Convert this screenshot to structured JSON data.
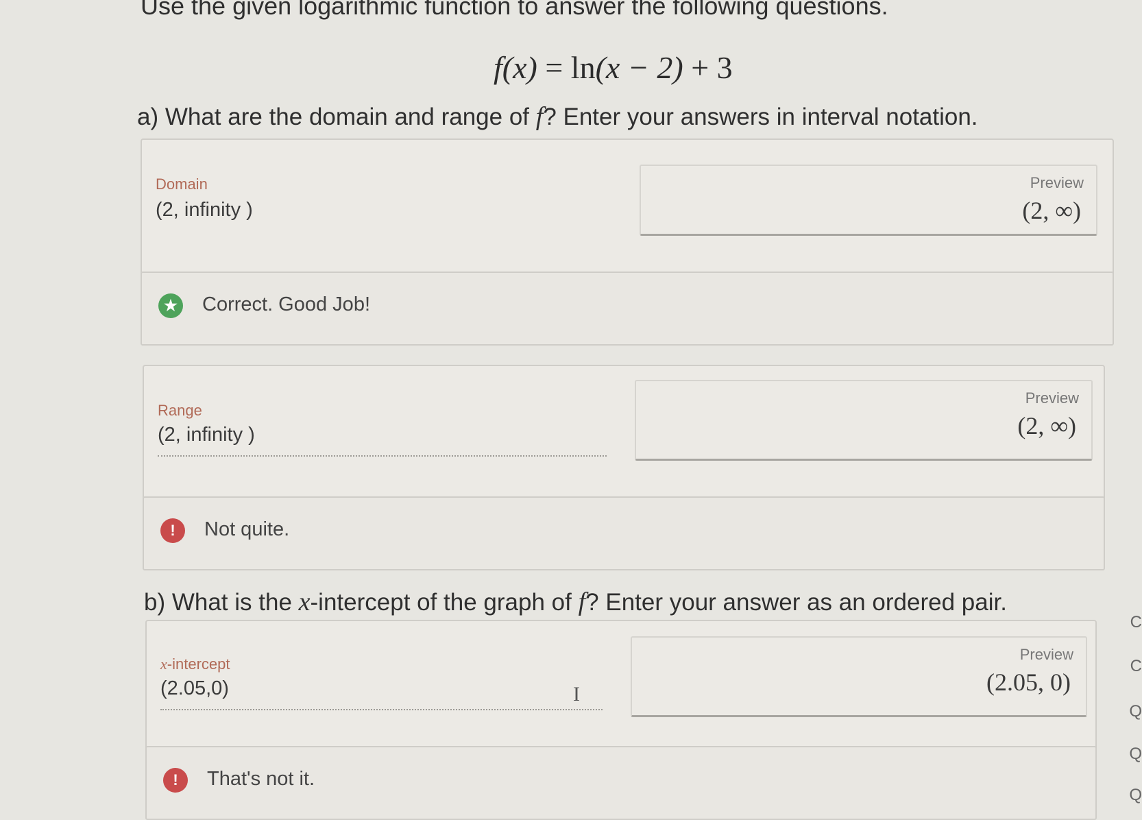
{
  "intro": "Use the given logarithmic function to answer the following questions.",
  "formula": {
    "lhs": "f(x)",
    "eq": "=",
    "ln": "ln",
    "arg": "(x − 2)",
    "rest": "+ 3"
  },
  "part_a": {
    "prefix": "a) What are the domain and range of ",
    "var": "f",
    "suffix": "? Enter your answers in interval notation.",
    "domain": {
      "label": "Domain",
      "value": "(2, infinity )",
      "preview_label": "Preview",
      "preview_value": "(2, ∞)",
      "feedback": "Correct. Good Job!",
      "feedback_icon": "star-icon",
      "feedback_color": "#4ea35b"
    },
    "range": {
      "label": "Range",
      "value": "(2, infinity )",
      "preview_label": "Preview",
      "preview_value": "(2, ∞)",
      "feedback": "Not quite.",
      "feedback_icon": "exclamation-icon",
      "feedback_color": "#c94b4b"
    }
  },
  "part_b": {
    "prefix": "b) What is the ",
    "var_x": "x",
    "middle": "-intercept of the graph of ",
    "var_f": "f",
    "suffix": "? Enter your answer as an ordered pair.",
    "xint": {
      "label_var": "x",
      "label_rest": "-intercept",
      "value": "(2.05,0)",
      "preview_label": "Preview",
      "preview_value": "(2.05, 0)",
      "feedback": "That's not it.",
      "feedback_icon": "exclamation-icon",
      "feedback_color": "#c94b4b"
    }
  },
  "edge_letters": [
    "C",
    "C",
    "Q",
    "Q",
    "Q"
  ]
}
